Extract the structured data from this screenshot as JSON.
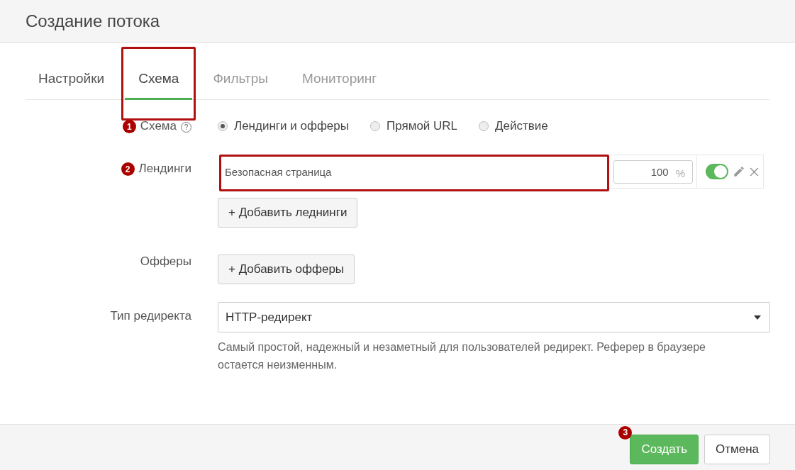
{
  "window": {
    "title": "Создание потока"
  },
  "tabs": [
    {
      "label": "Настройки",
      "selected": false,
      "highlighted": false
    },
    {
      "label": "Схема",
      "selected": true,
      "highlighted": true
    },
    {
      "label": "Фильтры",
      "selected": false,
      "highlighted": false
    },
    {
      "label": "Мониторинг",
      "selected": false,
      "highlighted": false
    }
  ],
  "schema": {
    "marker": "1",
    "label": "Схема",
    "help": "?",
    "options": [
      {
        "label": "Лендинги и офферы",
        "selected": true
      },
      {
        "label": "Прямой URL",
        "selected": false
      },
      {
        "label": "Действие",
        "selected": false
      }
    ]
  },
  "landings": {
    "marker": "2",
    "label": "Лендинги",
    "items": [
      {
        "name": "Безопасная страница",
        "highlighted": true,
        "weight": "100",
        "unit": "%",
        "on": true
      }
    ],
    "add_button": "+ Добавить леднинги"
  },
  "offers": {
    "label": "Офферы",
    "add_button": "+ Добавить офферы"
  },
  "redirect": {
    "label": "Тип редиректа",
    "value": "HTTP-редирект",
    "description": "Самый простой, надежный и незаметный для пользователей редирект. Реферер в браузере остается неизменным."
  },
  "footer": {
    "marker": "3",
    "buttons": [
      {
        "label": "Создать",
        "kind": "primary"
      },
      {
        "label": "Отмена",
        "kind": "default"
      }
    ]
  }
}
